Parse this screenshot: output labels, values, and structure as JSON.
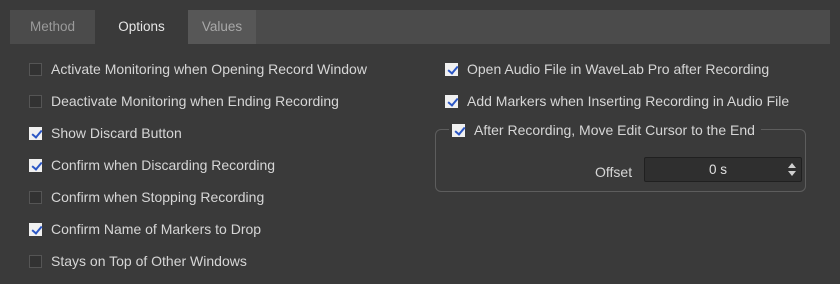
{
  "tabs": [
    {
      "label": "Method",
      "selected": false
    },
    {
      "label": "Options",
      "selected": true
    },
    {
      "label": "Values",
      "selected": false
    }
  ],
  "left_options": [
    {
      "label": "Activate Monitoring when Opening Record Window",
      "checked": false
    },
    {
      "label": "Deactivate Monitoring when Ending Recording",
      "checked": false
    },
    {
      "label": "Show Discard Button",
      "checked": true
    },
    {
      "label": "Confirm when Discarding Recording",
      "checked": true
    },
    {
      "label": "Confirm when Stopping Recording",
      "checked": false
    },
    {
      "label": "Confirm Name of Markers to Drop",
      "checked": true
    },
    {
      "label": "Stays on Top of Other Windows",
      "checked": false
    }
  ],
  "right_options": [
    {
      "label": "Open Audio File in WaveLab Pro after Recording",
      "checked": true
    },
    {
      "label": "Add Markers when Inserting Recording in Audio File",
      "checked": true
    }
  ],
  "move_cursor_group": {
    "label": "After Recording, Move Edit Cursor to the End",
    "checked": true,
    "offset_label": "Offset",
    "offset_value": "0 s"
  },
  "colors": {
    "background": "#3a3a3a",
    "checkmark": "#2b56c4",
    "text": "#d6d6d6"
  }
}
